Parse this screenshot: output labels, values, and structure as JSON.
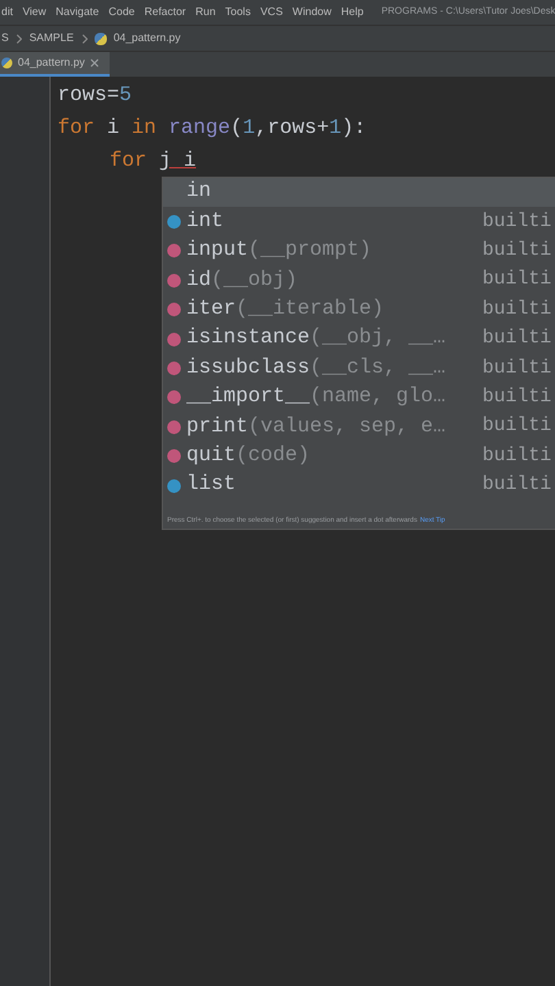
{
  "menu_bar": {
    "items": [
      "dit",
      "View",
      "Navigate",
      "Code",
      "Refactor",
      "Run",
      "Tools",
      "VCS",
      "Window",
      "Help"
    ],
    "title": "PROGRAMS - C:\\Users\\Tutor Joes\\Desk"
  },
  "breadcrumbs": [
    "S",
    "SAMPLE",
    "04_pattern.py"
  ],
  "tabs": [
    {
      "label": "04_pattern.py",
      "selected": true
    }
  ],
  "code_lines": [
    {
      "tokens": [
        {
          "kind": "plain",
          "text": "rows="
        },
        {
          "kind": "number",
          "text": "5"
        }
      ]
    },
    {
      "tokens": [
        {
          "kind": "keyword",
          "text": "for"
        },
        {
          "kind": "plain",
          "text": " i "
        },
        {
          "kind": "keyword",
          "text": "in"
        },
        {
          "kind": "builtin",
          "text": " range"
        },
        {
          "kind": "plain",
          "text": "("
        },
        {
          "kind": "number",
          "text": "1"
        },
        {
          "kind": "plain",
          "text": ",rows+"
        },
        {
          "kind": "number",
          "text": "1"
        },
        {
          "kind": "plain",
          "text": "):"
        }
      ],
      "children": [
        {
          "tokens": [
            {
              "kind": "keyword",
              "text": "for "
            },
            {
              "kind": "error",
              "text": "j i"
            }
          ]
        }
      ]
    }
  ],
  "completion": {
    "items": [
      {
        "kind": "keyword",
        "name": "in",
        "selected": true
      },
      {
        "kind": "class",
        "name": "int",
        "source": "builti",
        "selected": false
      },
      {
        "kind": "function",
        "name": "input",
        "params": "(__prompt)",
        "source": "builti",
        "selected": false
      },
      {
        "kind": "function",
        "name": "id",
        "params": "(__obj)",
        "source": "builti",
        "selected": false
      },
      {
        "kind": "function",
        "name": "iter",
        "params": "(__iterable)",
        "source": "builti",
        "selected": false
      },
      {
        "kind": "function",
        "name": "isinstance",
        "params": "(__obj, __…",
        "source": "builti",
        "selected": false
      },
      {
        "kind": "function",
        "name": "issubclass",
        "params": "(__cls, __…",
        "source": "builti",
        "selected": false
      },
      {
        "kind": "function",
        "name": "__import__",
        "params": "(name, glo…",
        "source": "builti",
        "selected": false
      },
      {
        "kind": "function",
        "name": "print",
        "params": "(values, sep, e…",
        "source": "builti",
        "selected": false
      },
      {
        "kind": "function",
        "name": "quit",
        "params": "(code)",
        "source": "builti",
        "selected": false
      },
      {
        "kind": "class",
        "name": "list",
        "source": "builti",
        "selected": false
      }
    ],
    "hint": "Press Ctrl+. to choose the selected (or first) suggestion and insert a dot afterwards",
    "hint_link": "Next Tip"
  }
}
